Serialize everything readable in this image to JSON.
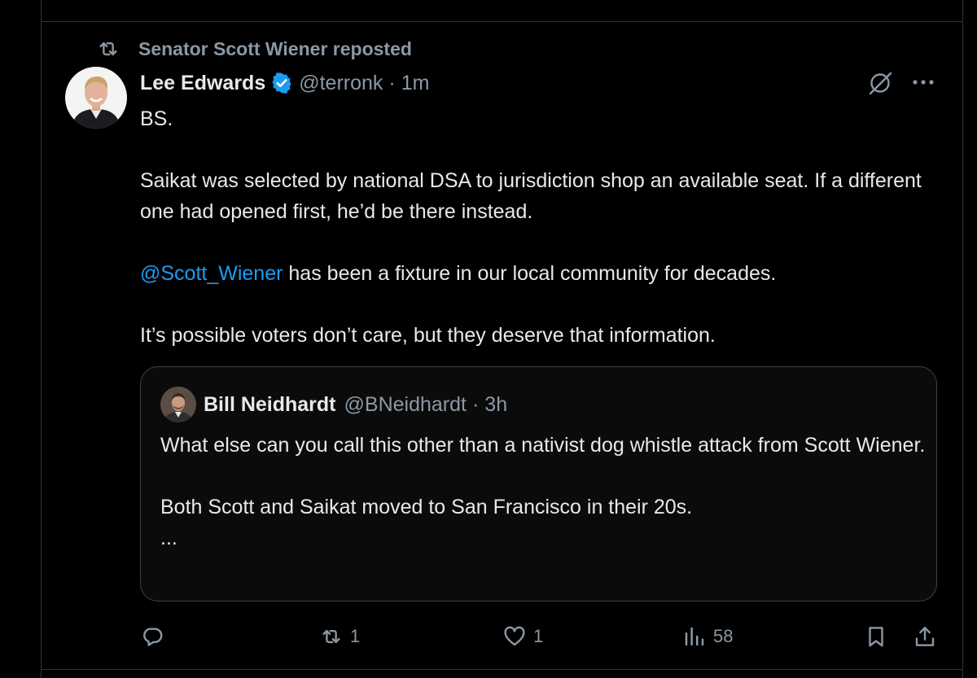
{
  "repost": {
    "text": "Senator Scott Wiener reposted",
    "icon": "repost-icon"
  },
  "tweet": {
    "author_name": "Lee Edwards",
    "handle": "@terronk",
    "separator": "·",
    "time": "1m",
    "paragraphs": [
      "BS.",
      "Saikat was selected by national DSA to jurisdiction shop an available seat. If a different one had opened first, he’d be there instead.",
      "has been a fixture in our local community for decades.",
      "It’s possible voters don’t care, but they deserve that information."
    ],
    "mention": "@Scott_Wiener"
  },
  "quote": {
    "author_name": "Bill Neidhardt",
    "handle": "@BNeidhardt",
    "separator": "·",
    "time": "3h",
    "paragraphs": [
      "What else can you call this other than a nativist dog whistle attack from Scott Wiener.",
      "Both Scott and Saikat moved to San Francisco in their 20s.",
      "..."
    ]
  },
  "actions": {
    "replies": "",
    "reposts": "1",
    "likes": "1",
    "views": "58"
  },
  "colors": {
    "background": "#000000",
    "text": "#e7e9ea",
    "muted": "#8b98a5",
    "accent": "#1d9bf0",
    "border": "#2f3336"
  }
}
